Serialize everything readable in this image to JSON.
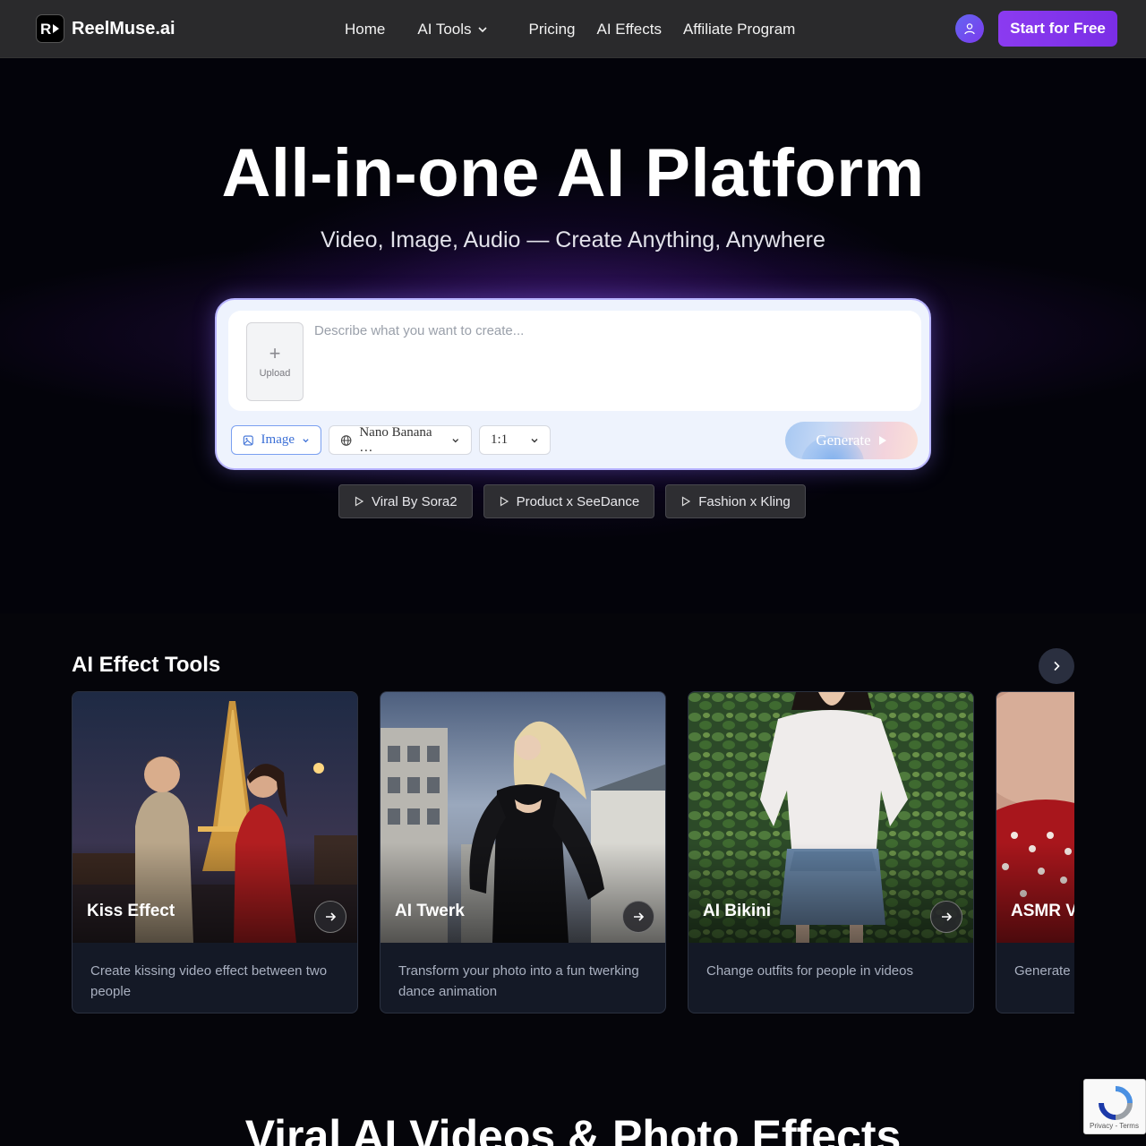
{
  "header": {
    "brand": "ReelMuse.ai",
    "logo_mark": "R",
    "nav": [
      {
        "label": "Home"
      },
      {
        "label": "AI Tools",
        "has_dropdown": true
      },
      {
        "label": "Pricing"
      },
      {
        "label": "AI Effects"
      },
      {
        "label": "Affiliate Program"
      }
    ],
    "user_icon": "user-icon",
    "cta_label": "Start for Free"
  },
  "hero": {
    "title": "All-in-one AI Platform",
    "subtitle": "Video, Image, Audio — Create Anything, Anywhere"
  },
  "composer": {
    "upload_label": "Upload",
    "prompt_placeholder": "Describe what you want to create...",
    "prompt_value": "",
    "type_selected": "Image",
    "model_selected": "Nano Banana …",
    "ratio_selected": "1:1",
    "generate_label": "Generate"
  },
  "chips": [
    {
      "label": "Viral By Sora2"
    },
    {
      "label": "Product x SeeDance"
    },
    {
      "label": "Fashion x Kling"
    }
  ],
  "effects": {
    "title": "AI Effect Tools",
    "cards": [
      {
        "title": "Kiss Effect",
        "desc": "Create kissing video effect between two people"
      },
      {
        "title": "AI Twerk",
        "desc": "Transform your photo into a fun twerking dance animation"
      },
      {
        "title": "AI Bikini",
        "desc": "Change outfits for people in videos"
      },
      {
        "title": "ASMR V",
        "desc": "Generate r satisfying"
      }
    ]
  },
  "bottom": {
    "title": "Viral AI Videos & Photo Effects"
  },
  "recaptcha": {
    "links": "Privacy - Terms"
  },
  "colors": {
    "accent": "#7c3aed",
    "header_bg": "#2a2a2c",
    "page_bg": "#05050a",
    "card_bg": "#141926"
  }
}
